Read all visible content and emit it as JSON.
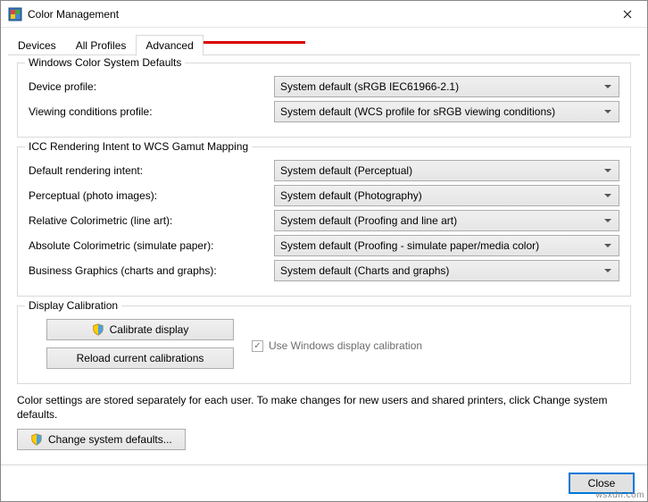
{
  "window": {
    "title": "Color Management"
  },
  "tabs": {
    "devices": "Devices",
    "all_profiles": "All Profiles",
    "advanced": "Advanced"
  },
  "group1": {
    "legend": "Windows Color System Defaults",
    "device_profile_label": "Device profile:",
    "device_profile_value": "System default (sRGB IEC61966-2.1)",
    "viewing_label": "Viewing conditions profile:",
    "viewing_value": "System default (WCS profile for sRGB viewing conditions)"
  },
  "group2": {
    "legend": "ICC Rendering Intent to WCS Gamut Mapping",
    "default_intent_label": "Default rendering intent:",
    "default_intent_value": "System default (Perceptual)",
    "perceptual_label": "Perceptual (photo images):",
    "perceptual_value": "System default (Photography)",
    "relative_label": "Relative Colorimetric (line art):",
    "relative_value": "System default (Proofing and line art)",
    "absolute_label": "Absolute Colorimetric (simulate paper):",
    "absolute_value": "System default (Proofing - simulate paper/media color)",
    "business_label": "Business Graphics (charts and graphs):",
    "business_value": "System default (Charts and graphs)"
  },
  "group3": {
    "legend": "Display Calibration",
    "calibrate_btn": "Calibrate display",
    "reload_btn": "Reload current calibrations",
    "checkbox_label": "Use Windows display calibration"
  },
  "footer": {
    "text": "Color settings are stored separately for each user. To make changes for new users and shared printers, click Change system defaults.",
    "change_defaults_btn": "Change system defaults..."
  },
  "actions": {
    "close": "Close"
  },
  "watermark": "wsxdn.com"
}
